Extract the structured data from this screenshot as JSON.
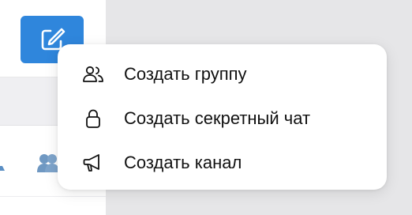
{
  "sidebar": {
    "compose_button": {
      "icon": "compose-icon",
      "color": "#2f86dc"
    },
    "partial_icons": [
      "person-icon",
      "group-icon"
    ]
  },
  "new_chat_menu": {
    "items": [
      {
        "label": "Создать группу",
        "icon": "group-icon"
      },
      {
        "label": "Создать секретный чат",
        "icon": "lock-icon"
      },
      {
        "label": "Создать канал",
        "icon": "megaphone-icon"
      }
    ]
  }
}
